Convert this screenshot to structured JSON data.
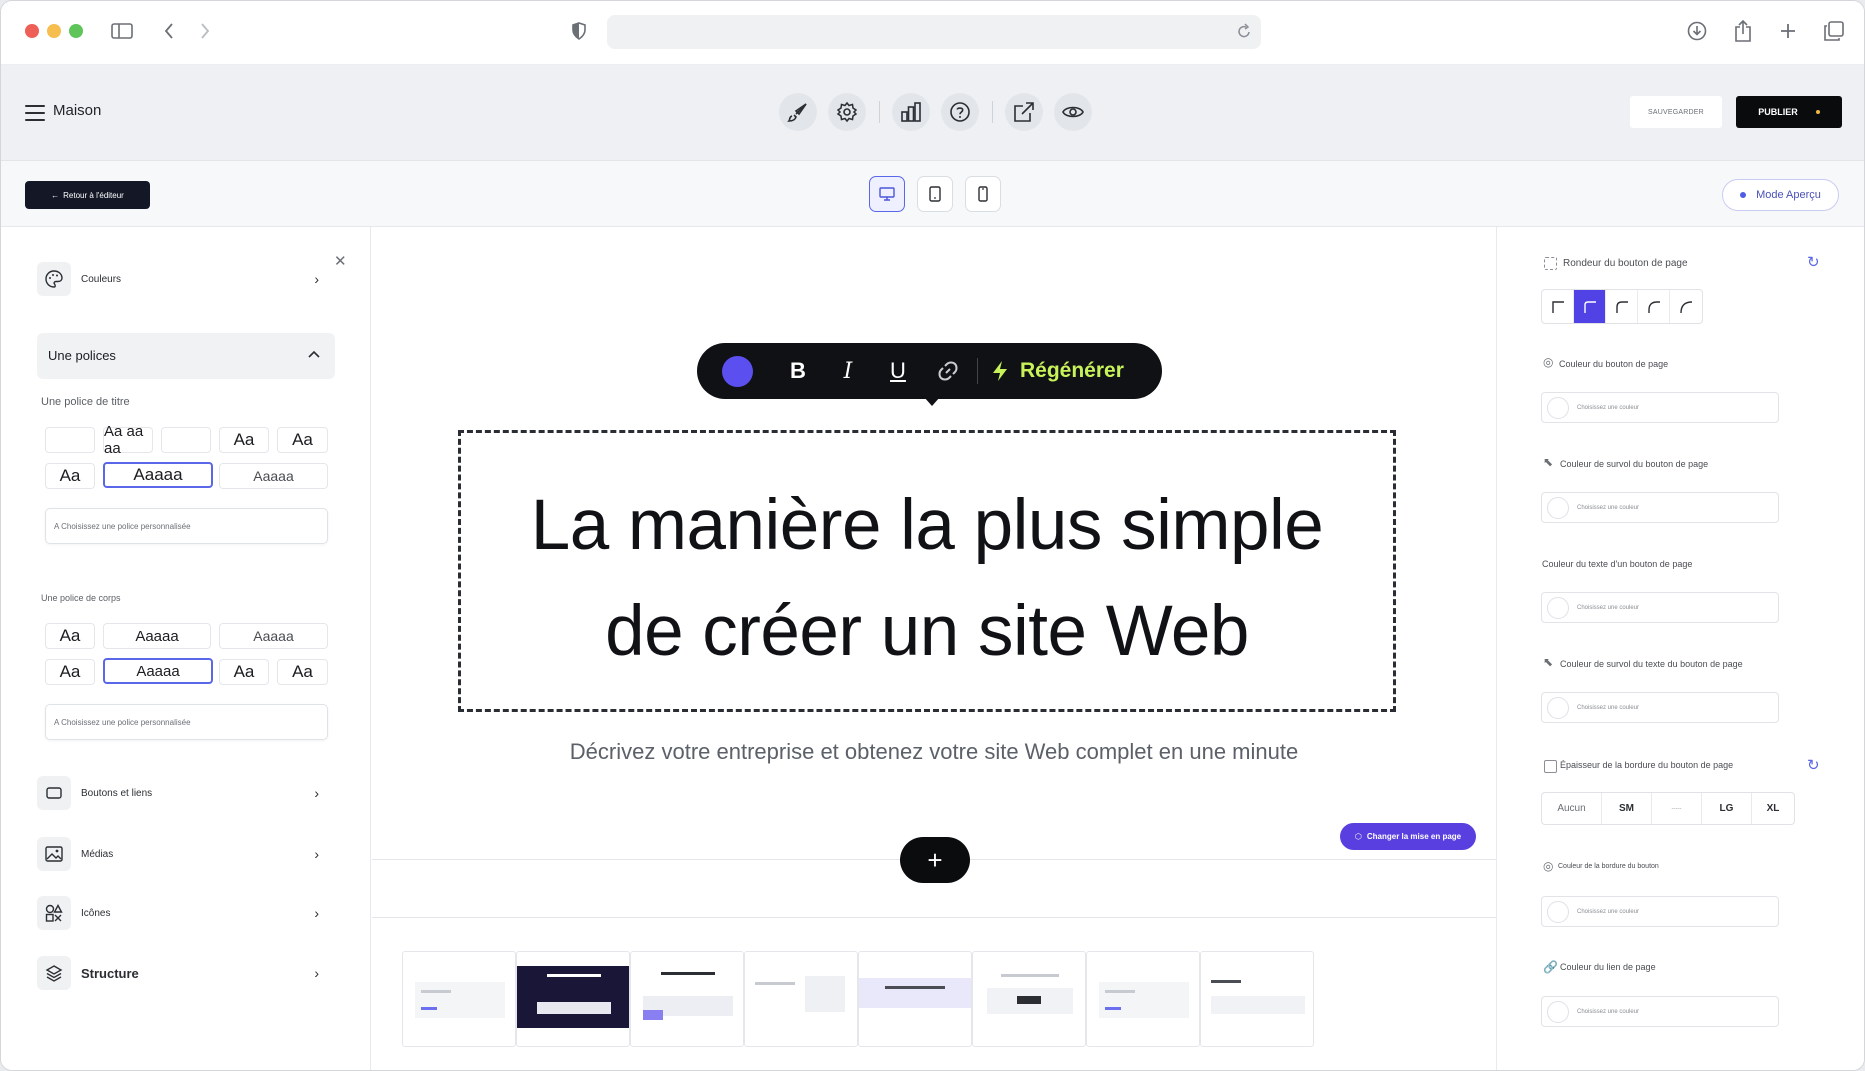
{
  "browser": {
    "url": ""
  },
  "header": {
    "site_name": "Maison",
    "save_label": "SAUVEGARDER",
    "publish_label": "PUBLIER"
  },
  "subheader": {
    "back_label": "Retour à l'éditeur",
    "mode_label": "Mode Aperçu"
  },
  "left_panel": {
    "colors_label": "Couleurs",
    "fonts_label": "Une polices",
    "title_font_label": "Une police de titre",
    "title_fonts": [
      "",
      "Aa aa aa",
      "",
      "Aa",
      "Aa",
      "Aa",
      "Aaaaa",
      "Aaaaa"
    ],
    "custom_font_placeholder": "A Choisissez une police personnalisée",
    "body_font_label": "Une police de corps",
    "body_fonts": [
      "Aa",
      "Aaaaa",
      "Aaaaa",
      "Aa",
      "Aaaaa",
      "Aa",
      "Aa"
    ],
    "custom_body_font_placeholder": "A Choisissez une police personnalisée",
    "buttons_label": "Boutons et liens",
    "media_label": "Médias",
    "icons_label": "Icônes",
    "structure_label": "Structure"
  },
  "canvas": {
    "toolbar": {
      "color": "#5b4ff0",
      "bold": "B",
      "italic": "I",
      "underline": "U",
      "regenerate_label": "Régénérer"
    },
    "hero_title_line1": "La manière la plus simple",
    "hero_title_line2": "de créer un site Web",
    "hero_subtitle": "Décrivez votre entreprise et obtenez votre site Web complet en une minute",
    "change_layout_label": "Changer la mise en page",
    "add_button": "+"
  },
  "right_panel": {
    "roundness_label": "Rondeur du bouton de page",
    "button_color_label": "Couleur du bouton de page",
    "button_hover_color_label": "Couleur de survol du bouton de page",
    "button_text_color_label": "Couleur du texte d'un bouton de page",
    "button_text_hover_color_label": "Couleur de survol du texte du bouton de page",
    "border_thickness_label": "Épaisseur de la bordure du bouton de page",
    "border_options": [
      "Aucun",
      "SM",
      "-----",
      "LG",
      "XL"
    ],
    "border_color_label": "Couleur de la bordure du bouton",
    "link_color_label": "Couleur du lien de page",
    "color_placeholder": "Choisissez une couleur"
  },
  "colors": {
    "accent": "#5142e6",
    "publish_bg": "#0a0b0d",
    "regen_text": "#c8f25a"
  }
}
